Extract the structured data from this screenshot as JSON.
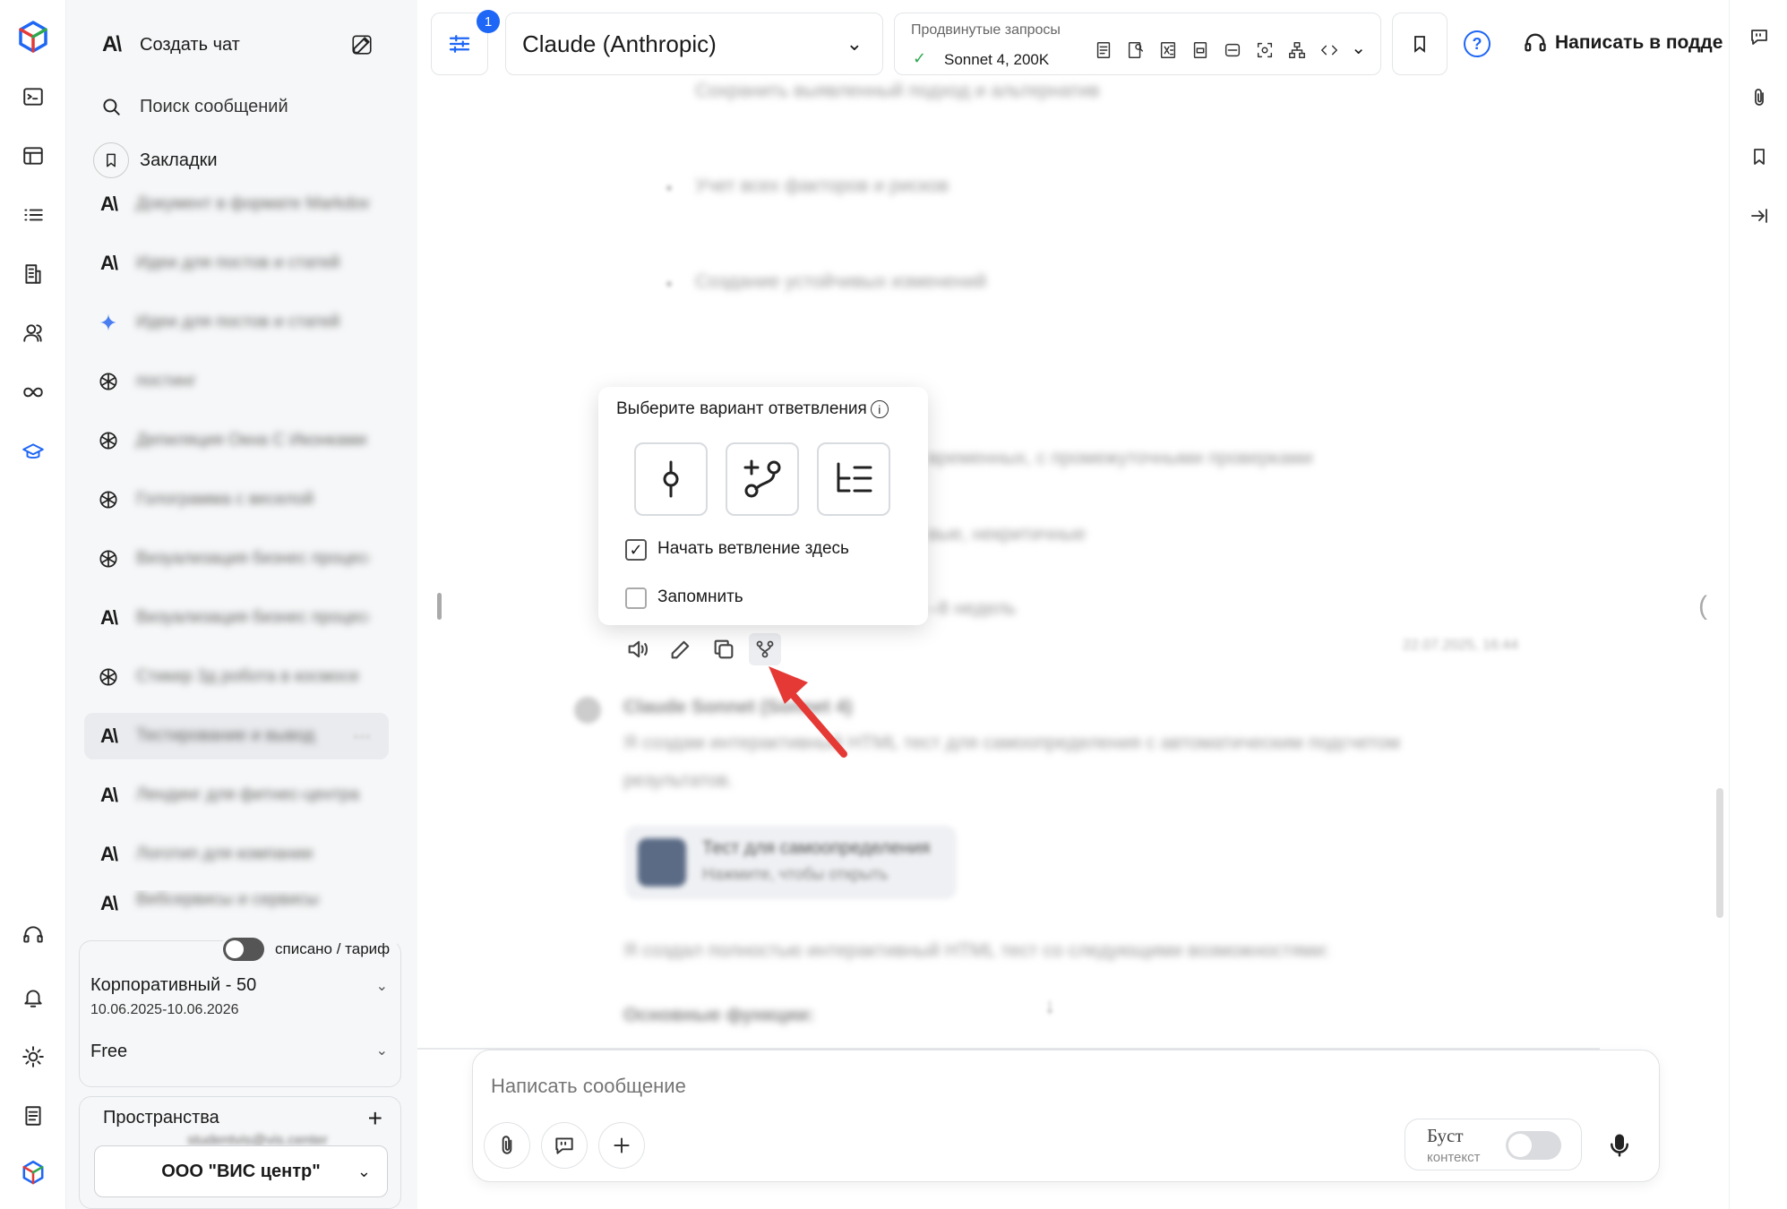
{
  "header": {
    "settings_badge": "1",
    "model_name": "Claude (Anthropic)",
    "advanced_label": "Продвинутые запросы",
    "advanced_model": "Sonnet 4, 200K",
    "support_label": "Написать в подде",
    "help_glyph": "?"
  },
  "sidebar": {
    "new_chat_label": "Создать чат",
    "search_label": "Поиск сообщений",
    "bookmarks_label": "Закладки",
    "chats": [
      {
        "icon": "anthropic-icon",
        "title": "Документ в формате Markdown"
      },
      {
        "icon": "anthropic-icon",
        "title": "Идеи для постов и статей"
      },
      {
        "icon": "gemini-icon",
        "title": "Идеи для постов и статей"
      },
      {
        "icon": "openai-icon",
        "title": "постинг"
      },
      {
        "icon": "openai-icon",
        "title": "Депиляция Окна С Иконками"
      },
      {
        "icon": "openai-icon",
        "title": "Голограмма с веселой"
      },
      {
        "icon": "openai-icon",
        "title": "Визуализация бизнес процессов"
      },
      {
        "icon": "anthropic-icon",
        "title": "Визуализация бизнес процессов"
      },
      {
        "icon": "openai-icon",
        "title": "Стикер 3д робота в космосе"
      },
      {
        "icon": "anthropic-icon",
        "title": "Тестирование и вывод"
      },
      {
        "icon": "anthropic-icon",
        "title": "Лендинг для фитнес-центра"
      },
      {
        "icon": "anthropic-icon",
        "title": "Логотип для компании"
      },
      {
        "icon": "anthropic-icon",
        "title": "Вебсервисы и сервисы"
      }
    ],
    "billing_toggle_label": "списано / тариф",
    "plan_name": "Корпоративный - 50",
    "plan_dates": "10.06.2025-10.06.2026",
    "plan_free": "Free",
    "spaces_label": "Пространства",
    "spaces_user": "studentvis@vis.center",
    "org_name": "ООО \"ВИС центр\""
  },
  "branch_popup": {
    "title": "Выберите вариант ответвления",
    "start_here_label": "Начать ветвление здесь",
    "start_here_checked": true,
    "remember_label": "Запомнить",
    "remember_checked": false
  },
  "chat": {
    "bullets": [
      "Сохранить выявленный подход и альтернатив",
      "Учет всех факторов и рисков",
      "Создание устойчивых изменений"
    ],
    "behind_popup_lines": [
      "временных, с промежуточными проверками",
      "вые, некритичные",
      "–8 недель"
    ],
    "timestamp": "22.07.2025, 16:44",
    "assistant_name": "Claude Sonnet (Sonnet 4)",
    "assistant_text_1": "Я создам интерактивный HTML тест для самоопределения с автоматическим подсчетом",
    "assistant_text_2": "результатов.",
    "artifact_title": "Тест для самоопределения",
    "artifact_sub": "Нажмите, чтобы открыть",
    "assistant_text_3": "Я создал полностью интерактивный HTML тест со следующими возможностями:",
    "section_title": "Основные функции:"
  },
  "composer": {
    "placeholder": "Написать сообщение",
    "boost_label": "Буст",
    "boost_sub": "контекст",
    "boost_on": false
  },
  "colors": {
    "accent_blue": "#1e66f5",
    "check_green": "#2fa84f",
    "arrow_red": "#e53935"
  }
}
